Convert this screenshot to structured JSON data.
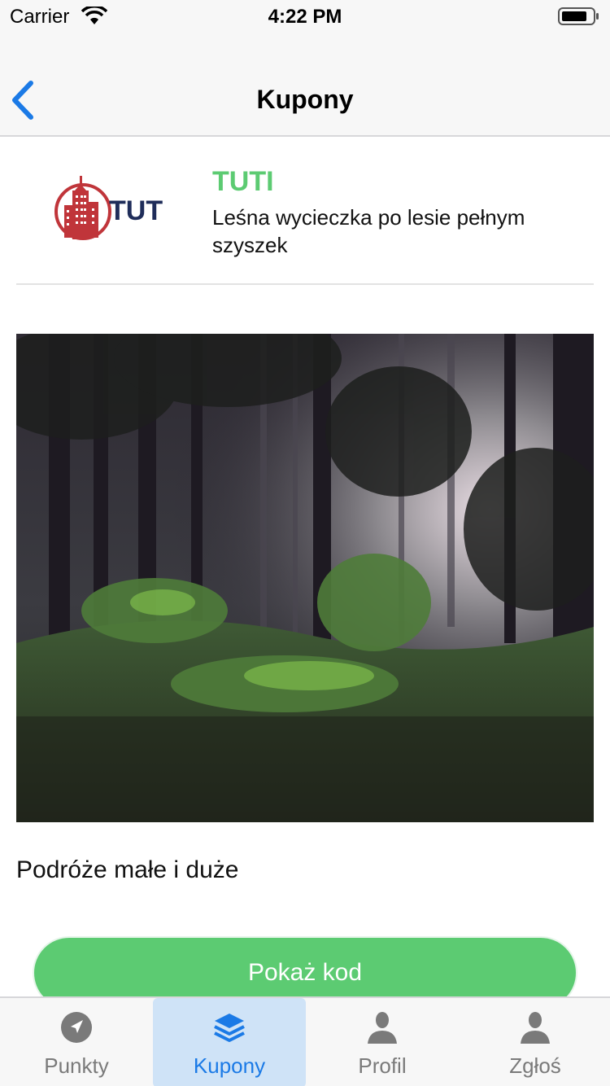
{
  "status_bar": {
    "carrier": "Carrier",
    "time": "4:22 PM"
  },
  "nav": {
    "title": "Kupony",
    "back_icon": "chevron-left-icon"
  },
  "merchant": {
    "logo_text": "TUTI",
    "name": "TUTI",
    "description": "Leśna wycieczka po lesie pełnym szyszek"
  },
  "hero": {
    "subject": "forest"
  },
  "coupon": {
    "caption": "Podróże małe i duże"
  },
  "actions": {
    "show_code_label": "Pokaż kod"
  },
  "tabs": [
    {
      "label": "Punkty",
      "icon": "navigation-arrow-icon",
      "active": false
    },
    {
      "label": "Kupony",
      "icon": "layers-icon",
      "active": true
    },
    {
      "label": "Profil",
      "icon": "person-icon",
      "active": false
    },
    {
      "label": "Zgłoś",
      "icon": "person-icon",
      "active": false
    }
  ],
  "colors": {
    "accent_green": "#5ccb72",
    "tab_active": "#1b7ae6",
    "tab_active_bg": "#cfe3f7",
    "logo_red": "#c0353a",
    "logo_navy": "#1f2d5a"
  }
}
